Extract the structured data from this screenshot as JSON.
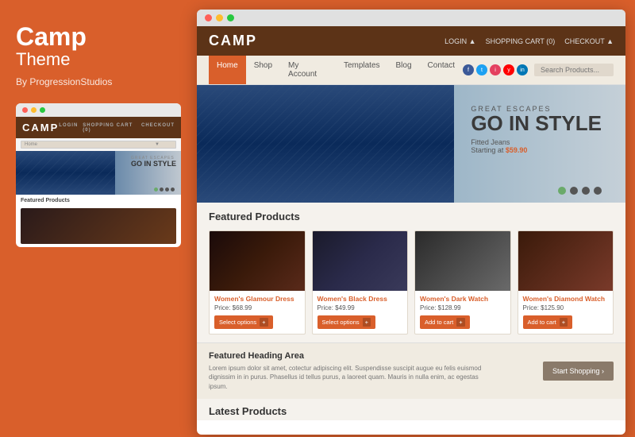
{
  "left": {
    "theme_name": "Camp",
    "theme_subtitle": "Theme",
    "by_text": "By ProgressionStudios"
  },
  "mini_browser": {
    "logo": "CAMP",
    "login": "LOGIN",
    "cart": "SHOPPING CART (0)",
    "checkout": "CHECKOUT",
    "home_dropdown": "Home",
    "featured_text": "Featured Products"
  },
  "browser": {
    "title_bar": "...",
    "site": {
      "logo": "CAMP",
      "login": "LOGIN ▲",
      "cart": "SHOPPING CART (0)",
      "checkout": "CHECKOUT ▲",
      "nav_links": [
        "Home",
        "Shop",
        "My Account",
        "Templates",
        "Blog",
        "Contact"
      ],
      "search_placeholder": "Search Products...",
      "hero": {
        "label": "GREAT ESCAPES",
        "headline": "GO IN STYLE",
        "product": "Fitted Jeans",
        "starting": "Starting at",
        "price": "$59.90"
      },
      "featured": {
        "title": "Featured Products",
        "products": [
          {
            "name": "Women's Glamour Dress",
            "price": "Price: $68.99",
            "button": "Select options"
          },
          {
            "name": "Women's Black Dress",
            "price": "Price: $49.99",
            "button": "Select options"
          },
          {
            "name": "Women's Dark Watch",
            "price": "Price: $128.99",
            "button": "Add to cart"
          },
          {
            "name": "Women's Diamond Watch",
            "price": "Price: $125.90",
            "button": "Add to cart"
          }
        ]
      },
      "featured_area": {
        "title": "Featured Heading Area",
        "text": "Lorem ipsum dolor sit amet, cotectur adipiscing elit. Suspendisse suscipit augue eu felis euismod dignissim in in purus. Phasellus id tellus purus, a laoreet quam. Mauris in nulla enim, ac egestas ipsum.",
        "button": "Start Shopping ›"
      },
      "latest": {
        "title": "Latest Products"
      }
    }
  }
}
